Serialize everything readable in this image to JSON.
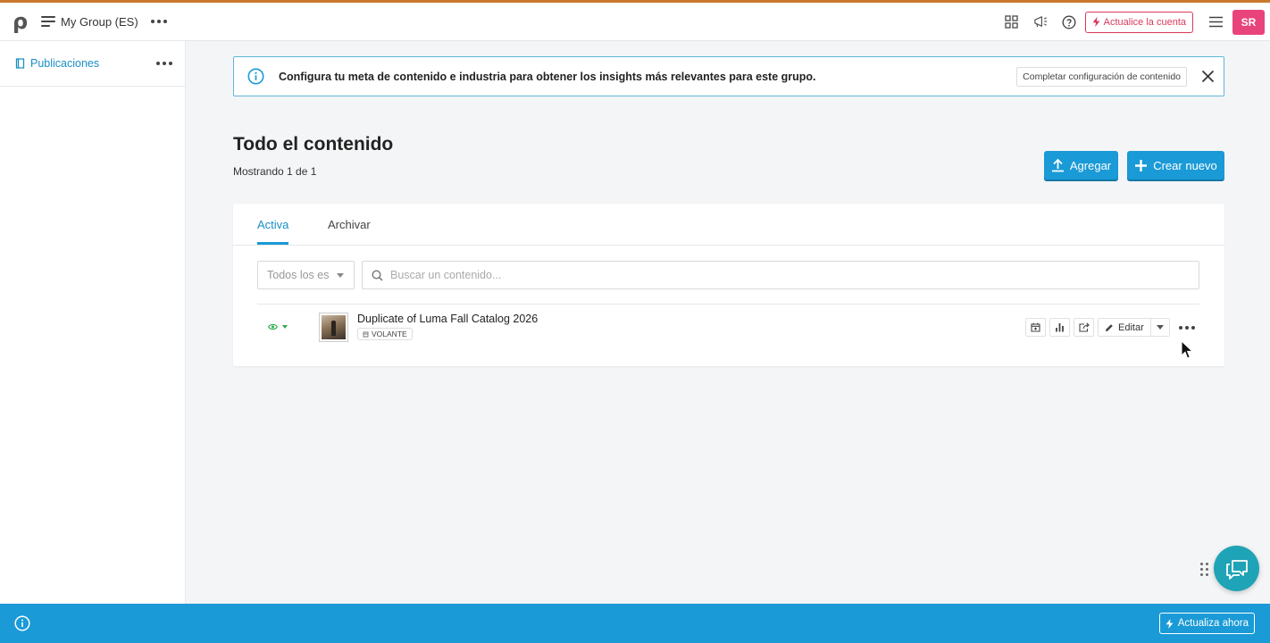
{
  "topbar": {
    "group_name": "My Group (ES)",
    "upgrade_label": "Actualice la cuenta",
    "avatar_initials": "SR",
    "accent_color": "#c9782b",
    "icons": [
      "apps-grid-icon",
      "megaphone-icon",
      "help-icon"
    ]
  },
  "sidebar": {
    "items": [
      {
        "label": "Publicaciones",
        "icon": "document-icon"
      }
    ]
  },
  "banner": {
    "text": "Configura tu meta de contenido e industria para obtener los insights más relevantes para este grupo.",
    "button_label": "Completar configuración de contenido"
  },
  "main": {
    "title": "Todo el contenido",
    "showing": "Mostrando 1 de 1",
    "add_label": "Agregar",
    "create_label": "Crear nuevo",
    "tabs": [
      {
        "label": "Activa",
        "active": true
      },
      {
        "label": "Archivar",
        "active": false
      }
    ],
    "filter": {
      "value": "Todos los es"
    },
    "search": {
      "placeholder": "Buscar un contenido..."
    },
    "items": [
      {
        "title": "Duplicate of Luma Fall Catalog 2026",
        "badge": "VOLANTE",
        "status_icon": "eye-icon",
        "edit_label": "Editar"
      }
    ]
  },
  "bottombar": {
    "button_label": "Actualiza ahora",
    "color": "#1a9ad6"
  },
  "colors": {
    "primary": "#1a9ad6",
    "upgrade": "#d9385a",
    "avatar": "#e8437a",
    "chat": "#1fa3b6"
  }
}
